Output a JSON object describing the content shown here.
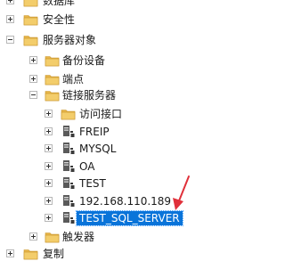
{
  "tree": {
    "database": {
      "label": "数据库",
      "icon": "folder-icon"
    },
    "security": {
      "label": "安全性",
      "icon": "folder-icon"
    },
    "server_objects": {
      "label": "服务器对象",
      "icon": "folder-icon",
      "expanded": true
    },
    "backup_devices": {
      "label": "备份设备",
      "icon": "folder-icon"
    },
    "endpoints": {
      "label": "端点",
      "icon": "folder-icon"
    },
    "linked_servers": {
      "label": "链接服务器",
      "icon": "folder-icon",
      "expanded": true
    },
    "providers": {
      "label": "访问接口",
      "icon": "folder-icon"
    },
    "servers": [
      {
        "label": "FREIP",
        "icon": "linked-server-icon"
      },
      {
        "label": "MYSQL",
        "icon": "linked-server-icon"
      },
      {
        "label": "OA",
        "icon": "linked-server-icon"
      },
      {
        "label": "TEST",
        "icon": "linked-server-icon"
      },
      {
        "label": "192.168.110.189",
        "icon": "linked-server-icon"
      },
      {
        "label": "TEST_SQL_SERVER",
        "icon": "linked-server-icon",
        "selected": true
      }
    ],
    "triggers": {
      "label": "触发器",
      "icon": "folder-icon"
    },
    "replication": {
      "label": "复制",
      "icon": "folder-icon"
    }
  },
  "colors": {
    "folder": "#e8b64a",
    "selection": "#0a74d9",
    "arrow": "#e0303a"
  }
}
